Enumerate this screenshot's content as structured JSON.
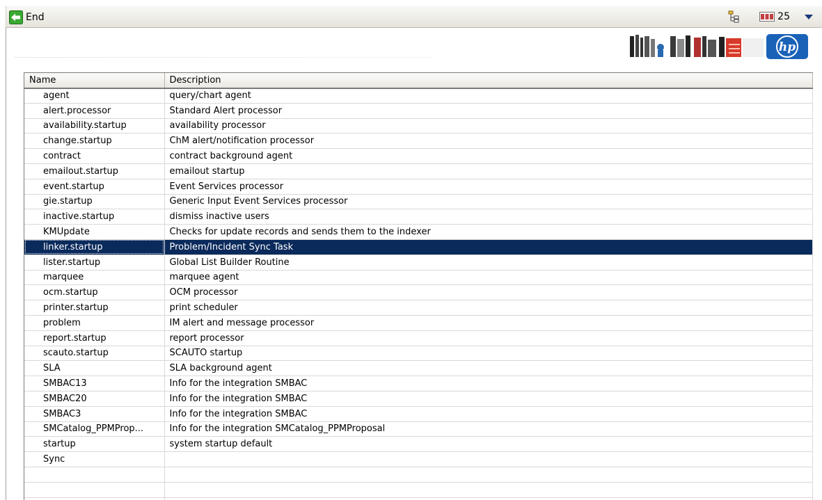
{
  "toolbar": {
    "end_label": "End",
    "record_count": "25",
    "icons": {
      "end": "back-arrow-icon",
      "tree": "tree-view-icon",
      "count": "record-count-icon",
      "menu": "dropdown-arrow-icon"
    }
  },
  "branding": {
    "logo_text": "hp"
  },
  "table": {
    "columns": [
      "Name",
      "Description"
    ],
    "selected_index": 10,
    "rows": [
      {
        "name": "agent",
        "description": "query/chart agent"
      },
      {
        "name": "alert.processor",
        "description": "Standard Alert processor"
      },
      {
        "name": "availability.startup",
        "description": "availability processor"
      },
      {
        "name": "change.startup",
        "description": "ChM alert/notification processor"
      },
      {
        "name": "contract",
        "description": "contract background agent"
      },
      {
        "name": "emailout.startup",
        "description": "emailout startup"
      },
      {
        "name": "event.startup",
        "description": "Event Services processor"
      },
      {
        "name": "gie.startup",
        "description": "Generic Input Event Services processor"
      },
      {
        "name": "inactive.startup",
        "description": "dismiss inactive users"
      },
      {
        "name": "KMUpdate",
        "description": "Checks for update records and sends them to the indexer"
      },
      {
        "name": "linker.startup",
        "description": "Problem/Incident Sync Task"
      },
      {
        "name": "lister.startup",
        "description": "Global List Builder Routine"
      },
      {
        "name": "marquee",
        "description": "marquee agent"
      },
      {
        "name": "ocm.startup",
        "description": "OCM processor"
      },
      {
        "name": "printer.startup",
        "description": "print scheduler"
      },
      {
        "name": "problem",
        "description": "IM alert and message processor"
      },
      {
        "name": "report.startup",
        "description": "report processor"
      },
      {
        "name": "scauto.startup",
        "description": "SCAUTO startup"
      },
      {
        "name": "SLA",
        "description": "SLA background agent"
      },
      {
        "name": "SMBAC13",
        "description": "Info for the integration SMBAC"
      },
      {
        "name": "SMBAC20",
        "description": "Info for the integration SMBAC"
      },
      {
        "name": "SMBAC3",
        "description": "Info for the integration SMBAC"
      },
      {
        "name": "SMCatalog_PPMProp...",
        "description": "Info for the integration SMCatalog_PPMProposal"
      },
      {
        "name": "startup",
        "description": "system startup default"
      },
      {
        "name": "Sync",
        "description": ""
      }
    ],
    "empty_rows": 3
  },
  "colors": {
    "selection": "#0a2a5c",
    "grid": "#d8d8d8",
    "toolbar": "#eceae2"
  }
}
